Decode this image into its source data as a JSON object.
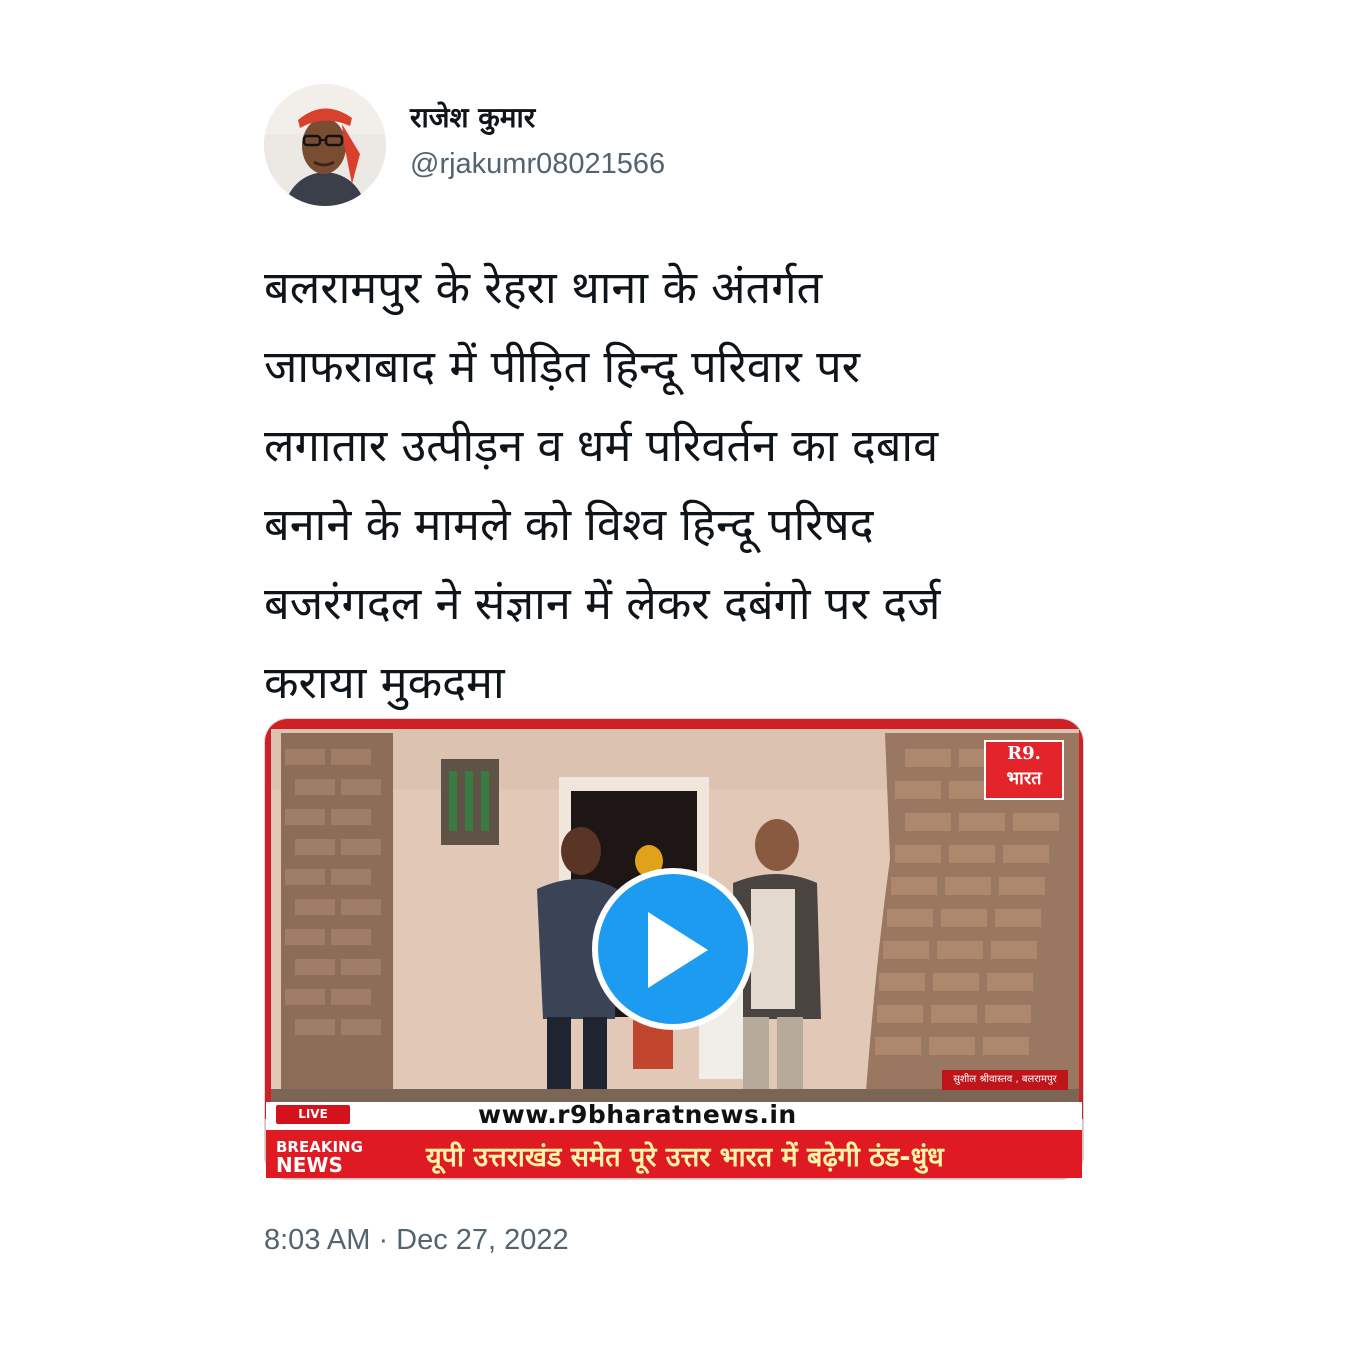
{
  "author": {
    "display_name": "राजेश कुमार",
    "handle": "@rjakumr08021566"
  },
  "tweet": {
    "text_lines": [
      "बलरामपुर के रेहरा थाना के अंतर्गत",
      "जाफराबाद में पीड़ित हिन्दू परिवार पर",
      "लगातार उत्पीड़न व धर्म परिवर्तन का दबाव",
      "बनाने के मामले को विश्व हिन्दू परिषद",
      "बजरंगदल ने संज्ञान में लेकर दबंगो पर दर्ज",
      "कराया मुकदमा"
    ],
    "timestamp": "8:03 AM · Dec 27, 2022"
  },
  "video": {
    "logo_top": "R9.",
    "logo_bottom": "भारत",
    "reporter_caption": "सुशील श्रीवास्तव , बलरामपुर",
    "live_label": "LIVE",
    "url": "www.r9bharatnews.in",
    "breaking_label_1": "BREAKING",
    "breaking_label_2": "NEWS",
    "headline": "यूपी उत्तराखंड समेत पूरे उत्तर भारत में बढ़ेगी ठंड-धुंध"
  },
  "colors": {
    "accent": "#1d9bf0",
    "secondary_text": "#536471",
    "breaking_red": "#e01a22"
  },
  "icons": [
    "play-icon",
    "avatar-image"
  ]
}
